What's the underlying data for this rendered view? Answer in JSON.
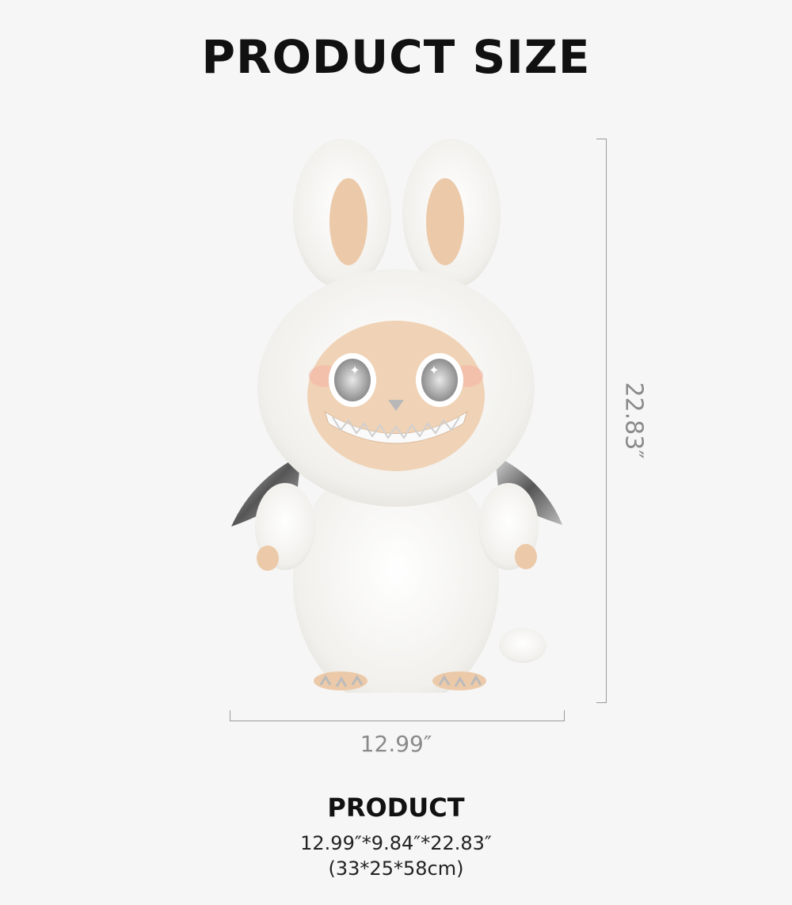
{
  "title": "PRODUCT SIZE",
  "dimensions": {
    "height_label": "22.83″",
    "width_label": "12.99″"
  },
  "product": {
    "heading": "PRODUCT",
    "size_inches": "12.99″*9.84″*22.83″",
    "size_cm": "(33*25*58cm)"
  },
  "figure_icon": "white-furry-monster-doll-with-wings"
}
